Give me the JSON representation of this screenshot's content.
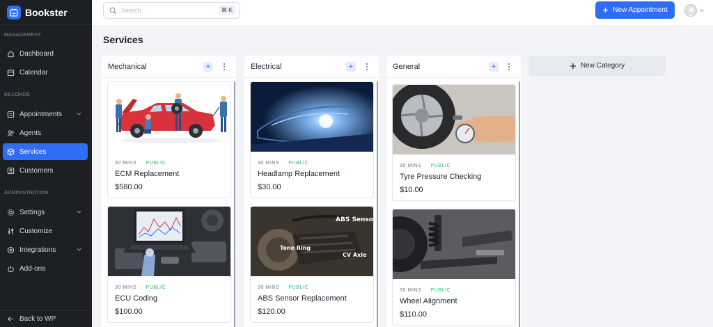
{
  "app": {
    "name": "Bookster"
  },
  "sidebar": {
    "sections": [
      {
        "label": "MANAGEMENT"
      },
      {
        "label": "RECORDS"
      },
      {
        "label": "ADMINISTRATION"
      }
    ],
    "items": [
      {
        "label": "Dashboard",
        "icon": "dashboard-icon"
      },
      {
        "label": "Calendar",
        "icon": "calendar-icon"
      },
      {
        "label": "Appointments",
        "icon": "appointments-icon"
      },
      {
        "label": "Agents",
        "icon": "agents-icon"
      },
      {
        "label": "Services",
        "icon": "services-icon",
        "active": true
      },
      {
        "label": "Customers",
        "icon": "customers-icon"
      },
      {
        "label": "Settings",
        "icon": "gear-icon"
      },
      {
        "label": "Customize",
        "icon": "customize-icon"
      },
      {
        "label": "Integrations",
        "icon": "integrations-icon"
      },
      {
        "label": "Add-ons",
        "icon": "power-icon"
      }
    ],
    "back_label": "Back to WP"
  },
  "topbar": {
    "search_placeholder": "Search...",
    "shortcut": "⌘ K",
    "new_appointment_label": "New Appointment"
  },
  "main": {
    "title": "Services",
    "new_category_label": "New Category",
    "categories": [
      {
        "name": "Mechanical",
        "services": [
          {
            "duration": "30 MINS",
            "visibility": "PUBLIC",
            "title": "ECM Replacement",
            "price": "$580.00"
          },
          {
            "duration": "30 MINS",
            "visibility": "PUBLIC",
            "title": "ECU Coding",
            "price": "$100.00"
          }
        ]
      },
      {
        "name": "Electrical",
        "services": [
          {
            "duration": "30 MINS",
            "visibility": "PUBLIC",
            "title": "Headlamp Replacement",
            "price": "$30.00"
          },
          {
            "duration": "30 MINS",
            "visibility": "PUBLIC",
            "title": "ABS Sensor Replacement",
            "price": "$120.00"
          }
        ]
      },
      {
        "name": "General",
        "services": [
          {
            "duration": "30 MINS",
            "visibility": "PUBLIC",
            "title": "Tyre Pressure Checking",
            "price": "$10.00"
          },
          {
            "duration": "30 MINS",
            "visibility": "PUBLIC",
            "title": "Wheel Alignment",
            "price": "$110.00"
          }
        ]
      }
    ],
    "image_labels": {
      "abs_sensor": "ABS Sensor",
      "tone_ring": "Tone Ring",
      "cv_axle": "CV Axle"
    }
  },
  "colors": {
    "accent": "#2f6df6",
    "sidebar_bg": "#1c1f24",
    "public": "#28b77a"
  }
}
